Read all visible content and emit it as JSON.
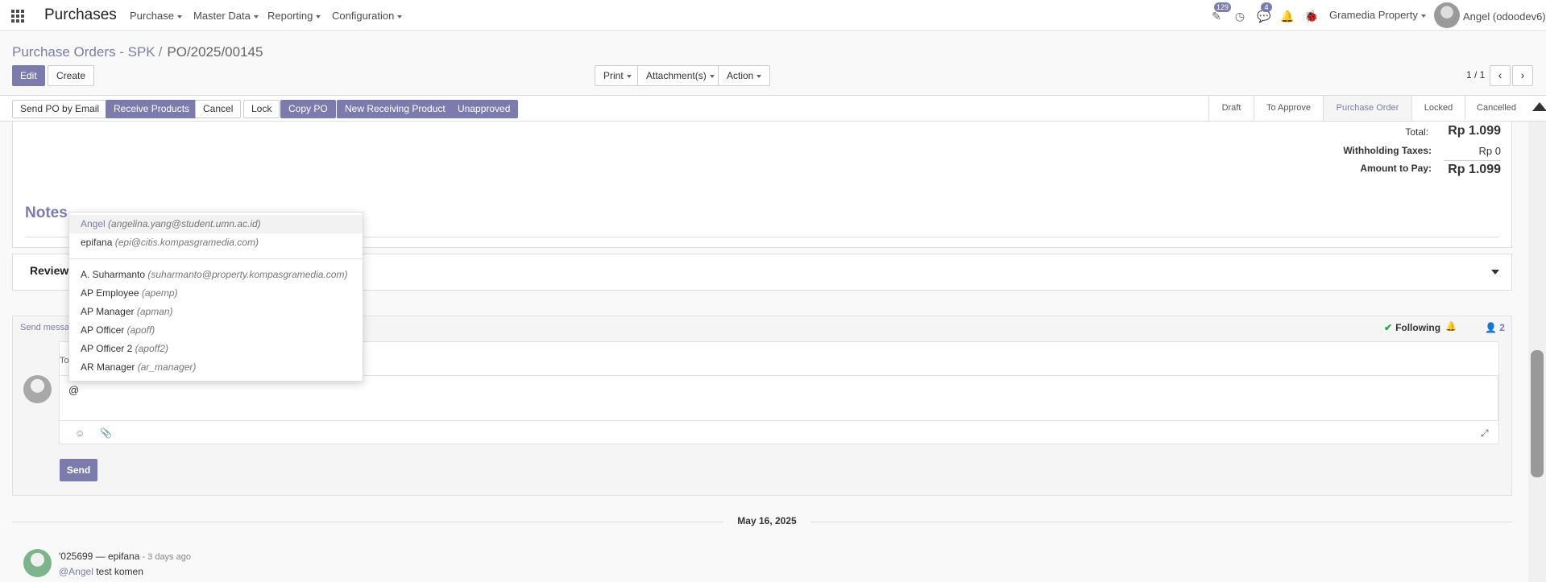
{
  "navbar": {
    "app_title": "Purchases",
    "menus": [
      "Purchase",
      "Master Data",
      "Reporting",
      "Configuration"
    ],
    "activity_badge": "129",
    "messages_badge": "4",
    "company": "Gramedia Property",
    "user": "Angel (odoodev6)",
    "icons": [
      "apps-grid-icon",
      "activity-edit-icon",
      "clock-icon",
      "chat-bubbles-icon",
      "bell-icon",
      "bug-icon"
    ]
  },
  "breadcrumb": {
    "parent": "Purchase Orders - SPK",
    "separator": "/",
    "current": "PO/2025/00145"
  },
  "buttons": {
    "edit": "Edit",
    "create": "Create",
    "print": "Print",
    "attachments": "Attachment(s)",
    "action": "Action"
  },
  "pager": {
    "value": "1 / 1",
    "prev": "‹",
    "next": "›"
  },
  "statusbar": {
    "actions": [
      "Send PO by Email",
      "Receive Products",
      "Cancel",
      "Lock",
      "Copy PO",
      "New Receiving Product",
      "Unapproved"
    ],
    "stages": [
      "Draft",
      "To Approve",
      "Purchase Order",
      "Locked",
      "Cancelled"
    ],
    "active_stage": "Purchase Order"
  },
  "totals": {
    "total_label": "Total:",
    "total_value": "Rp 1.099",
    "withholding_label": "Withholding Taxes:",
    "withholding_value": "Rp 0",
    "amount_label": "Amount to Pay:",
    "amount_value": "Rp 1.099"
  },
  "notes_title": "Notes",
  "review_title": "Review",
  "chatter": {
    "send_message": "Send messa",
    "following": "Following",
    "followers_count": "2",
    "to_label": "To",
    "composer_text": "@",
    "emoji_icon": "☺",
    "attach_icon": "📎",
    "expand_icon": "⤢",
    "send": "Send"
  },
  "date_separator": "May 16, 2025",
  "message": {
    "author": "'025699 — epifana",
    "ago": " - 3 days ago",
    "mention": "@Angel",
    "text": " test komen"
  },
  "mention_dropdown": {
    "group1": [
      {
        "name": "Angel",
        "email": "(angelina.yang@student.umn.ac.id)"
      },
      {
        "name": "epifana",
        "email": "(epi@citis.kompasgramedia.com)"
      }
    ],
    "group2": [
      {
        "name": "A. Suharmanto",
        "email": "(suharmanto@property.kompasgramedia.com)"
      },
      {
        "name": "AP Employee",
        "email": "(apemp)"
      },
      {
        "name": "AP Manager",
        "email": "(apman)"
      },
      {
        "name": "AP Officer",
        "email": "(apoff)"
      },
      {
        "name": "AP Officer 2",
        "email": "(apoff2)"
      },
      {
        "name": "AR Manager",
        "email": "(ar_manager)"
      }
    ]
  },
  "colors": {
    "accent": "#7c7bad",
    "check": "#28a745"
  }
}
